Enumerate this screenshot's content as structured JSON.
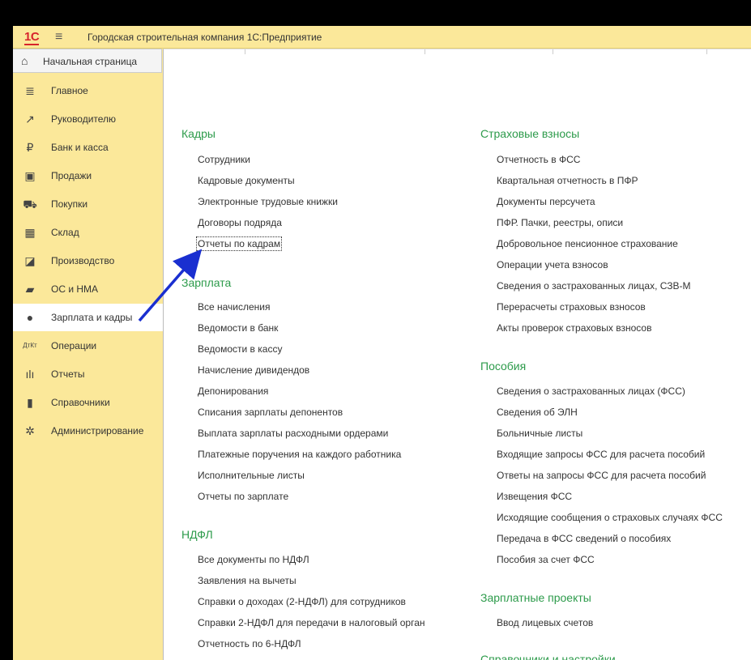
{
  "window": {
    "title": "Городская строительная компания 1С:Предприятие",
    "logo": "1С"
  },
  "sidebar": {
    "home": {
      "label": "Начальная страница",
      "icon": "home-icon"
    },
    "items": [
      {
        "label": "Главное",
        "icon": "list-icon"
      },
      {
        "label": "Руководителю",
        "icon": "trend-icon"
      },
      {
        "label": "Банк и касса",
        "icon": "ruble-coin-icon"
      },
      {
        "label": "Продажи",
        "icon": "shopping-bag-icon"
      },
      {
        "label": "Покупки",
        "icon": "cart-icon"
      },
      {
        "label": "Склад",
        "icon": "warehouse-icon"
      },
      {
        "label": "Производство",
        "icon": "factory-icon"
      },
      {
        "label": "ОС и НМА",
        "icon": "truck-icon"
      },
      {
        "label": "Зарплата и кадры",
        "icon": "person-icon",
        "active": true
      },
      {
        "label": "Операции",
        "icon": "debit-credit-icon"
      },
      {
        "label": "Отчеты",
        "icon": "bar-chart-icon"
      },
      {
        "label": "Справочники",
        "icon": "book-icon"
      },
      {
        "label": "Администрирование",
        "icon": "gear-icon"
      }
    ]
  },
  "sections": {
    "kadry": {
      "title": "Кадры",
      "links": [
        "Сотрудники",
        "Кадровые документы",
        "Электронные трудовые книжки",
        "Договоры подряда",
        "Отчеты по кадрам"
      ]
    },
    "zarplata": {
      "title": "Зарплата",
      "links": [
        "Все начисления",
        "Ведомости в банк",
        "Ведомости в кассу",
        "Начисление дивидендов",
        "Депонирования",
        "Списания зарплаты депонентов",
        "Выплата зарплаты расходными ордерами",
        "Платежные поручения на каждого работника",
        "Исполнительные листы",
        "Отчеты по зарплате"
      ]
    },
    "ndfl": {
      "title": "НДФЛ",
      "links": [
        "Все документы по НДФЛ",
        "Заявления на вычеты",
        "Справки о доходах (2-НДФЛ) для сотрудников",
        "Справки 2-НДФЛ для передачи в налоговый орган",
        "Отчетность по 6-НДФЛ"
      ]
    },
    "strakh": {
      "title": "Страховые взносы",
      "links": [
        "Отчетность в ФСС",
        "Квартальная отчетность в ПФР",
        "Документы персучета",
        "ПФР. Пачки, реестры, описи",
        "Добровольное пенсионное страхование",
        "Операции учета взносов",
        "Сведения о застрахованных лицах, СЗВ-М",
        "Перерасчеты страховых взносов",
        "Акты проверок страховых взносов"
      ]
    },
    "posobiya": {
      "title": "Пособия",
      "links": [
        "Сведения о застрахованных лицах (ФСС)",
        "Сведения об ЭЛН",
        "Больничные листы",
        "Входящие запросы ФСС для расчета пособий",
        "Ответы на запросы ФСС для расчета пособий",
        "Извещения ФСС",
        "Исходящие сообщения о страховых случаях ФСС",
        "Передача в ФСС сведений о пособиях",
        "Пособия за счет ФСС"
      ]
    },
    "proekty": {
      "title": "Зарплатные проекты",
      "links": [
        "Ввод лицевых счетов"
      ]
    },
    "spravochniki": {
      "title": "Справочники и настройки"
    }
  },
  "colors": {
    "sidebar": "#fbe89a",
    "section_title": "#2d9b4b",
    "arrow": "#1a2fd0",
    "logo": "#d7242c"
  }
}
